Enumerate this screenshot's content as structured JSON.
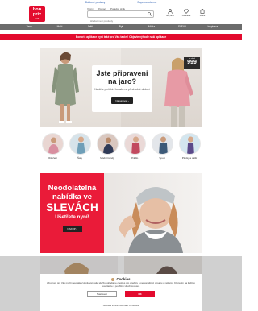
{
  "topbar": {
    "left": "Dárkové poukazy",
    "right": "Doprava zdarma"
  },
  "header": {
    "logo": {
      "line1": "bon",
      "line2": "prix",
      "line3": "váš"
    },
    "links": [
      "Vzory",
      "Pomoc",
      "Poradce stylu"
    ],
    "search_placeholder": "Hledat mezi produkty",
    "icons": [
      {
        "name": "account-icon",
        "label": "Můj účet"
      },
      {
        "name": "wishlist-icon",
        "label": "Oblíbené"
      },
      {
        "name": "cart-icon",
        "label": "Košík"
      }
    ]
  },
  "nav": [
    "Ženy",
    "Muži",
    "Děti",
    "Byt",
    "Móda",
    "SLEVY",
    "Inspirace"
  ],
  "promo": "Bonprix aplikace nyní také pro Váš tablet! Objevte výhody naší aplikace",
  "hero1": {
    "title": "Jste připraveni na jaro?",
    "text": "Najděte perfektní kousky na přechodné období",
    "button": "Nakupovat",
    "tag_text": "ve slevě",
    "tag_value": "999"
  },
  "categories": [
    {
      "label": "Oblečení"
    },
    {
      "label": "Šaty"
    },
    {
      "label": "Módní trendy"
    },
    {
      "label": "Prádlo"
    },
    {
      "label": "Sport"
    },
    {
      "label": "Plavky a další"
    }
  ],
  "hero2": {
    "line1": "Neodolatelná",
    "line2": "nabídka ve",
    "big": "SLEVÁCH",
    "sub": "Ušetřete nyní!",
    "button": "NAKUP"
  },
  "cookie": {
    "title": "Cookies",
    "text": "Abychom pro Vás mohli neustále vylepšovat naše služby, ukládáme cookies pro analýzu a personalizaci obsahu a reklamy. Kliknutím na tlačítko souhlasíte s použitím všech cookies.",
    "decline": "Nastavení",
    "accept": "OK",
    "link": "Souhlas a více informací o cookies"
  },
  "colors": {
    "brand_red": "#e30b2e",
    "nav_gray": "#6c6c6c"
  }
}
